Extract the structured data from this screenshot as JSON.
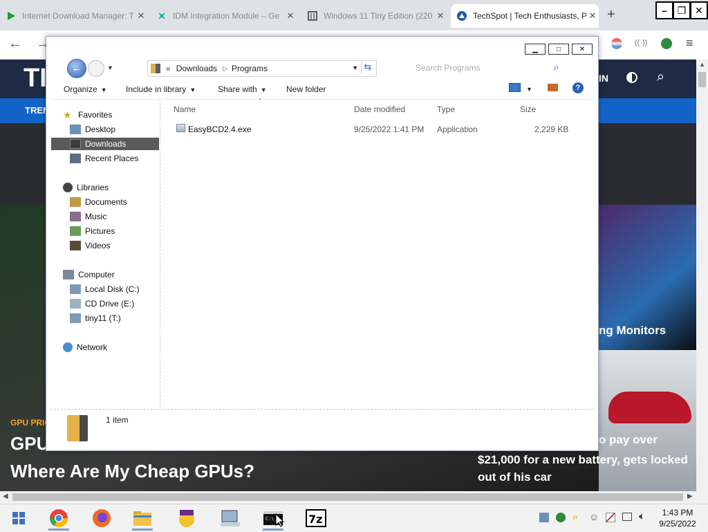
{
  "browser": {
    "tabs": [
      {
        "title": "Internet Download Manager: T",
        "icon": "play-icon"
      },
      {
        "title": "IDM Integration Module – Ge",
        "icon": "puzzle-icon"
      },
      {
        "title": "Windows 11 Tiny Edition (220",
        "icon": "page-icon"
      },
      {
        "title": "TechSpot | Tech Enthusiasts, P",
        "icon": "techspot-icon",
        "active": true
      }
    ],
    "new_tab": "+",
    "window_controls": {
      "minimize": "–",
      "maximize": "❐",
      "close": "✕"
    }
  },
  "website": {
    "logo_fragment": "TI",
    "nav_fragment": "TREN",
    "header_right_fragment": "IN",
    "left_badge": "GPU PRIC",
    "left_headline_top": "GPU",
    "left_headline_bottom": "Where Are My Cheap GPUs?",
    "right_mid_headline": "ng Monitors",
    "right_bottom_fragment": "o pay over",
    "right_bottom_headline": "$21,000 for a new battery, gets locked out of his car"
  },
  "explorer": {
    "breadcrumb": [
      "Downloads",
      "Programs"
    ],
    "breadcrumb_prefix": "«",
    "search_placeholder": "Search Programs",
    "toolbar": {
      "organize": "Organize",
      "include_in_library": "Include in library",
      "share_with": "Share with",
      "new_folder": "New folder"
    },
    "nav": {
      "favorites": "Favorites",
      "desktop": "Desktop",
      "downloads": "Downloads",
      "recent_places": "Recent Places",
      "libraries": "Libraries",
      "documents": "Documents",
      "music": "Music",
      "pictures": "Pictures",
      "videos": "Videos",
      "computer": "Computer",
      "local_disk": "Local Disk (C:)",
      "cd_drive": "CD Drive (E:)",
      "tiny11": "tiny11 (T:)",
      "network": "Network"
    },
    "columns": {
      "name": "Name",
      "date": "Date modified",
      "type": "Type",
      "size": "Size"
    },
    "files": [
      {
        "name": "EasyBCD2.4.exe",
        "date": "9/25/2022 1:41 PM",
        "type": "Application",
        "size": "2,229 KB"
      }
    ],
    "item_count": "1 item"
  },
  "taskbar": {
    "time": "1:43 PM",
    "date": "9/25/2022"
  }
}
